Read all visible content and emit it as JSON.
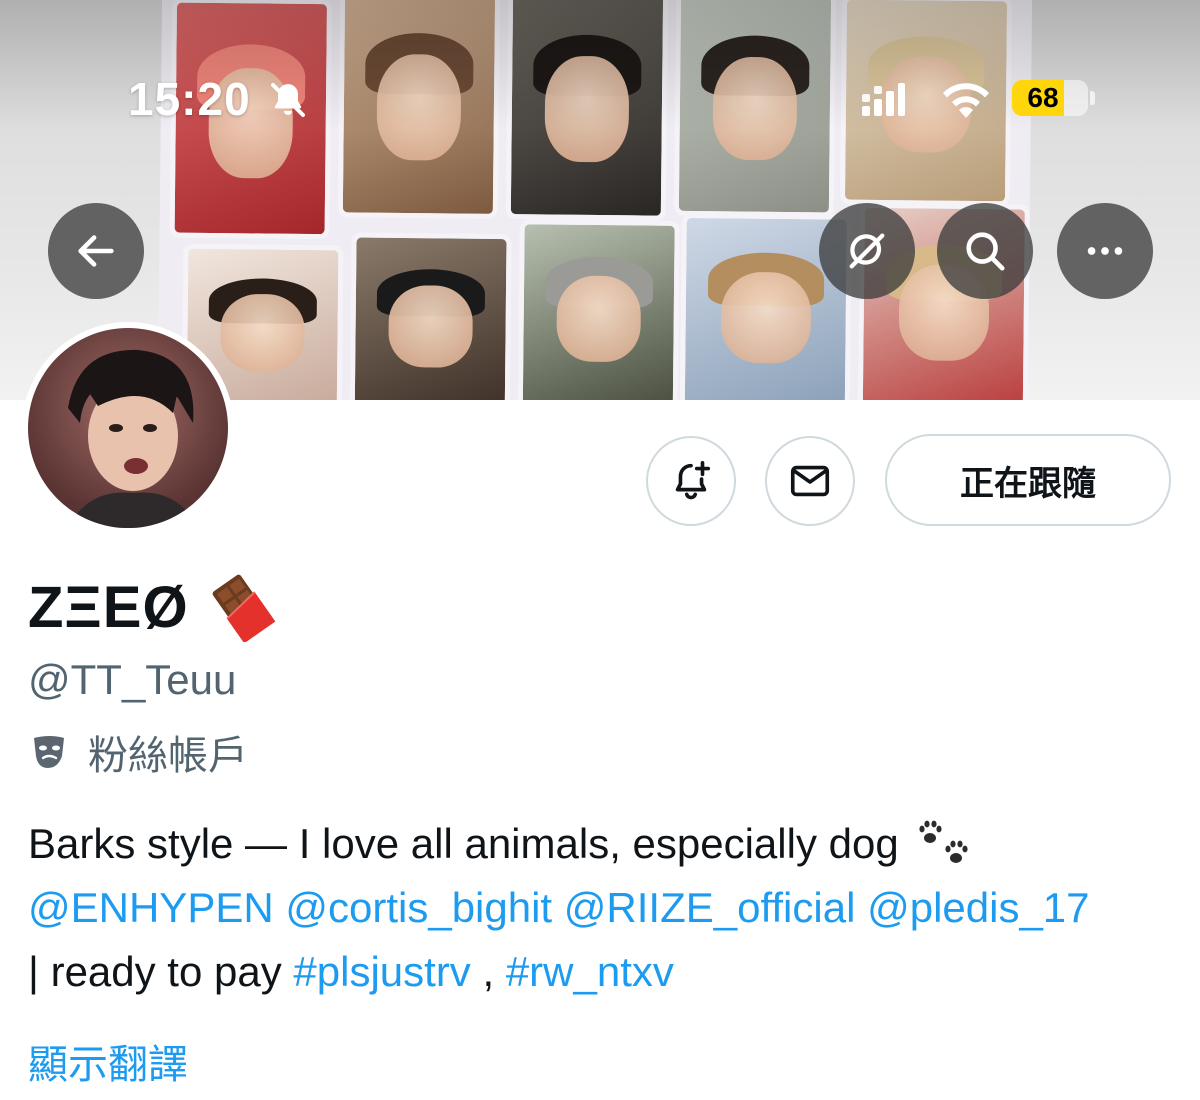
{
  "status_bar": {
    "time": "15:20",
    "battery_level": "68",
    "battery_fraction": 0.68,
    "icons": [
      "bell-off-icon",
      "signal-icon",
      "wifi-icon",
      "battery-icon"
    ]
  },
  "nav": {
    "back_icon": "arrow-left-icon",
    "grok_icon": "slash-circle-icon",
    "search_icon": "search-icon",
    "more_icon": "more-horizontal-icon"
  },
  "actions": {
    "notify_icon": "bell-plus-icon",
    "message_icon": "mail-icon",
    "following_label": "正在跟隨"
  },
  "profile": {
    "display_name": "ZΞEØ",
    "name_emoji": "chocolate-bar-icon",
    "handle": "@TT_Teuu",
    "account_type": "粉絲帳戶",
    "account_type_icon": "mask-icon",
    "bio_line1": "Barks style — I love all animals, especially dog",
    "bio_paw_icon": "paw-prints-icon",
    "mentions": [
      "@ENHYPEN",
      "@cortis_bighit",
      "@RIIZE_official",
      "@pledis_17"
    ],
    "bio_line3_prefix": "| ready to pay",
    "hashtags": [
      "#plsjustrv",
      "#rw_ntxv"
    ],
    "hashtag_separator": ",",
    "translate_label": "顯示翻譯"
  },
  "colors": {
    "link_blue": "#1d9bf0",
    "secondary_text": "#536471",
    "primary_text": "#0f1419",
    "battery_yellow": "#ffd60a"
  }
}
